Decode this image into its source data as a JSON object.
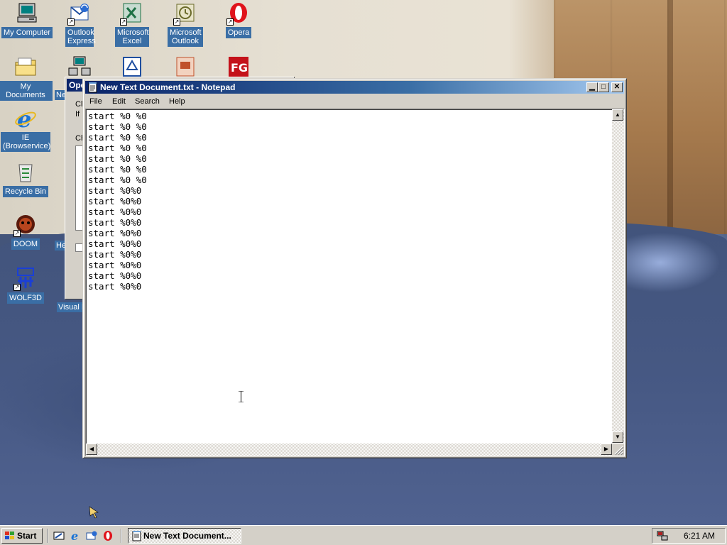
{
  "desktop": {
    "icons": [
      {
        "label": "My Computer",
        "icon": "my-computer-icon"
      },
      {
        "label": "Outlook Express",
        "icon": "outlook-express-icon"
      },
      {
        "label": "Microsoft Excel",
        "icon": "excel-icon"
      },
      {
        "label": "Microsoft Outlook",
        "icon": "outlook-icon"
      },
      {
        "label": "Opera",
        "icon": "opera-icon"
      },
      {
        "label": "My Documents",
        "icon": "my-documents-icon"
      },
      {
        "label": "IE (Browservice)",
        "icon": "internet-explorer-icon"
      },
      {
        "label": "Recycle Bin",
        "icon": "recycle-bin-icon"
      },
      {
        "label": "DOOM",
        "icon": "doom-icon"
      },
      {
        "label": "WOLF3D",
        "icon": "wolf3d-icon"
      },
      {
        "label": "Ne",
        "icon": "network-icon"
      },
      {
        "label": "He",
        "icon": "help-icon"
      },
      {
        "label": "Visual I",
        "icon": "visual-icon"
      }
    ]
  },
  "background_window": {
    "title": "Ope",
    "lines": [
      "Cli",
      "If",
      "Ch"
    ]
  },
  "notepad": {
    "title": "New Text Document.txt - Notepad",
    "menu": {
      "file": "File",
      "edit": "Edit",
      "search": "Search",
      "help": "Help"
    },
    "content": "start %0 %0\nstart %0 %0\nstart %0 %0\nstart %0 %0\nstart %0 %0\nstart %0 %0\nstart %0 %0\nstart %0%0\nstart %0%0\nstart %0%0\nstart %0%0\nstart %0%0\nstart %0%0\nstart %0%0\nstart %0%0\nstart %0%0\nstart %0%0"
  },
  "taskbar": {
    "start_label": "Start",
    "quick_launch": [
      "show-desktop-icon",
      "internet-explorer-icon",
      "outlook-express-icon",
      "opera-icon"
    ],
    "task_label": "New Text Document...",
    "clock": "6:21 AM"
  },
  "colors": {
    "titlebar_active": "#0a246a",
    "desktop_label_bg": "#3a6ea5",
    "face": "#d4d0c8"
  }
}
